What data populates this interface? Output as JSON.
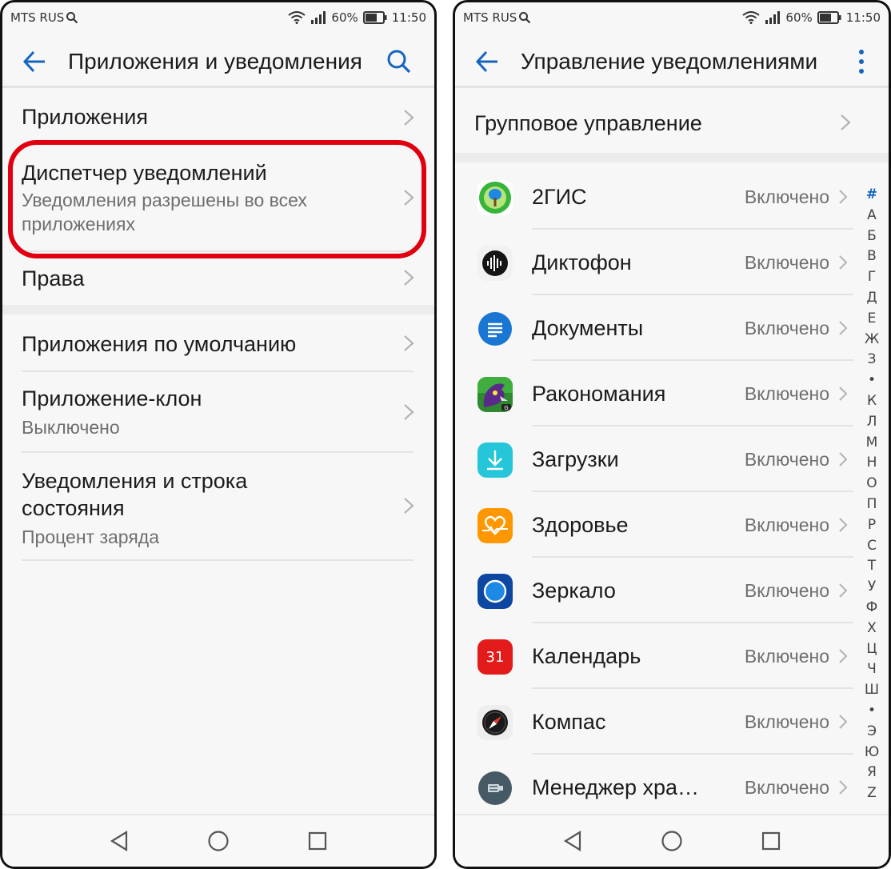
{
  "status_bar": {
    "carrier": "MTS RUS",
    "battery": "60%",
    "time": "11:50"
  },
  "left_screen": {
    "title": "Приложения и уведомления",
    "items": [
      {
        "label": "Приложения"
      },
      {
        "label": "Диспетчер уведомлений",
        "sub": "Уведомления разрешены во всех",
        "sub2": "приложениях"
      },
      {
        "label": "Права"
      },
      {
        "label": "Приложения по умолчанию"
      },
      {
        "label": "Приложение-клон",
        "sub": "Выключено"
      },
      {
        "label": "Уведомления и строка",
        "label2": "состояния",
        "sub": "Процент заряда"
      }
    ]
  },
  "right_screen": {
    "title": "Управление уведомлениями",
    "group_item": "Групповое управление",
    "apps": [
      {
        "name": "2ГИС",
        "status": "Включено"
      },
      {
        "name": "Диктофон",
        "status": "Включено"
      },
      {
        "name": "Документы",
        "status": "Включено"
      },
      {
        "name": "Ракономания",
        "status": "Включено"
      },
      {
        "name": "Загрузки",
        "status": "Включено"
      },
      {
        "name": "Здоровье",
        "status": "Включено"
      },
      {
        "name": "Зеркало",
        "status": "Включено"
      },
      {
        "name": "Календарь",
        "status": "Включено"
      },
      {
        "name": "Компас",
        "status": "Включено"
      },
      {
        "name": "Менеджер хра…",
        "status": "Включено"
      }
    ],
    "calendar_day": "31",
    "alphabet": [
      "#",
      "А",
      "Б",
      "В",
      "Г",
      "Д",
      "Е",
      "Ж",
      "З",
      "•",
      "К",
      "Л",
      "М",
      "Н",
      "О",
      "П",
      "Р",
      "С",
      "Т",
      "У",
      "Ф",
      "Х",
      "Ц",
      "Ч",
      "Ш",
      "•",
      "Э",
      "Ю",
      "Я",
      "Z"
    ]
  },
  "colors": {
    "accent": "#1565c0",
    "highlight": "#e00010"
  }
}
